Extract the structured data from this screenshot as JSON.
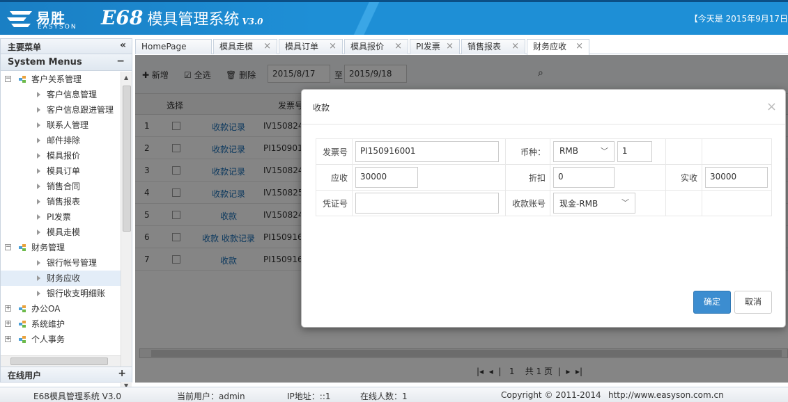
{
  "header": {
    "logo_cn": "易胜",
    "logo_en": "EASYSON",
    "title_e68": "E68",
    "title_cn": "模具管理系统",
    "title_ver": "V3.0",
    "date_text": "【今天是 2015年9月17日"
  },
  "sidebar": {
    "main_menu_label": "主要菜单",
    "collapse_glyph": "«",
    "system_menus_label": "System Menus",
    "online_users_label": "在线用户",
    "groups": [
      {
        "label": "客户关系管理",
        "expanded": true,
        "items": [
          "客户信息管理",
          "客户信息跟进管理",
          "联系人管理",
          "邮件排除",
          "模具报价",
          "模具订单",
          "销售合同",
          "销售报表",
          "PI发票",
          "模具走模"
        ]
      },
      {
        "label": "财务管理",
        "expanded": true,
        "items": [
          "银行帐号管理",
          "财务应收",
          "银行收支明细账"
        ]
      },
      {
        "label": "办公OA",
        "expanded": false,
        "items": []
      },
      {
        "label": "系统维护",
        "expanded": false,
        "items": []
      },
      {
        "label": "个人事务",
        "expanded": false,
        "items": []
      }
    ],
    "selected_item": "财务应收"
  },
  "tabs": [
    {
      "label": "HomePage",
      "closable": false
    },
    {
      "label": "模具走模",
      "closable": true
    },
    {
      "label": "模具订单",
      "closable": true
    },
    {
      "label": "模具报价",
      "closable": true
    },
    {
      "label": "PI发票",
      "closable": true
    },
    {
      "label": "销售报表",
      "closable": true
    },
    {
      "label": "财务应收",
      "closable": true,
      "active": true
    }
  ],
  "toolbar": {
    "add_label": "新增",
    "select_all_label": "全选",
    "delete_label": "删除",
    "date_from": "2015/8/17",
    "date_sep": "至",
    "date_to": "2015/9/18"
  },
  "grid": {
    "headers": {
      "select": "选择",
      "invoice_no": "发票号"
    },
    "rows": [
      {
        "n": "1",
        "action": "收款记录",
        "invoice": "IV150824"
      },
      {
        "n": "2",
        "action": "收款记录",
        "invoice": "PI150901"
      },
      {
        "n": "3",
        "action": "收款记录",
        "invoice": "IV150824"
      },
      {
        "n": "4",
        "action": "收款记录",
        "invoice": "IV150825"
      },
      {
        "n": "5",
        "action": "收款",
        "invoice": "IV150824"
      },
      {
        "n": "6",
        "action": "收款 收款记录",
        "invoice": "PI150916"
      },
      {
        "n": "7",
        "action": "收款",
        "invoice": "PI150916"
      }
    ],
    "pager_page": "1",
    "pager_total": "共 1 页"
  },
  "modal": {
    "title": "收款",
    "close_glyph": "×",
    "invoice_label": "发票号",
    "invoice_value": "PI150916001",
    "currency_label": "币种：",
    "currency_value": "RMB",
    "rate_value": "1",
    "receivable_label": "应收",
    "receivable_value": "30000",
    "discount_label": "折扣",
    "discount_value": "0",
    "actual_label": "实收",
    "actual_value": "30000",
    "voucher_label": "凭证号",
    "voucher_value": "",
    "account_label": "收款账号",
    "account_value": "现金-RMB",
    "ok_label": "确定",
    "cancel_label": "取消"
  },
  "footer": {
    "system": "E68模具管理系统 V3.0",
    "user": "当前用户：admin",
    "ip": "IP地址：::1",
    "online": "在线人数：1",
    "copyright": "Copyright © 2011-2014",
    "url": "http://www.easyson.com.cn"
  },
  "colors": {
    "header_blue": "#1e8fd6",
    "primary_button": "#3c8dd0",
    "link": "#1a6db5"
  }
}
